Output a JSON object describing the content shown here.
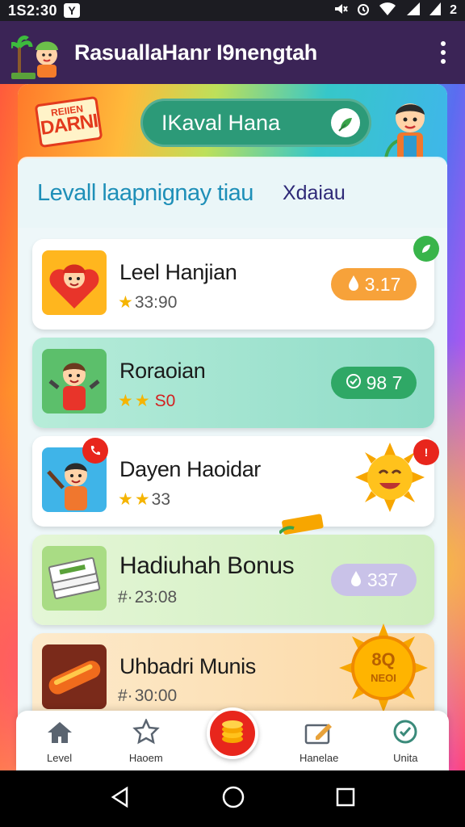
{
  "status_bar": {
    "time": "1S2:30",
    "notification": "Y",
    "battery": "2"
  },
  "app_bar": {
    "title": "RasuallaHanr I9nengtah",
    "logo_icon": "palm-tree-kid-icon",
    "menu_icon": "more-vert-icon"
  },
  "banner": {
    "badge_line1": "REIIEN",
    "badge_line2": "DARNI",
    "pill_text": "IKaval Hana"
  },
  "level_header": {
    "title": "Levall laapnignay tiau",
    "subtitle": "Xdaiau"
  },
  "items": [
    {
      "title": "Leel Hanjian",
      "meta": "33:90",
      "pill": "3.17",
      "stars": 1,
      "pill_color": "#f7a23a",
      "bg": "#ffffff"
    },
    {
      "title": "Roraoian",
      "meta": "S0",
      "pill": "98 7",
      "stars": 2,
      "pill_color": "#2fa866",
      "bg": "#8fdcc8"
    },
    {
      "title": "Dayen Haoidar",
      "meta": "33",
      "stars": 2,
      "bg": "#ffffff"
    },
    {
      "title": "Hadiuhah Bonus",
      "meta": "23:08",
      "pill": "337",
      "pill_color": "#c9c2e8",
      "bg": "#d9f1c9"
    },
    {
      "title": "Uhbadri Munis",
      "meta": "30:00",
      "bg": "#fde0b4",
      "sun_text_1": "8Q",
      "sun_text_2": "NEOI"
    }
  ],
  "bottom_nav": {
    "items": [
      {
        "label": "Level",
        "icon": "home-icon"
      },
      {
        "label": "Haoem",
        "icon": "puzzle-star-icon"
      },
      {
        "label": "",
        "icon": "coins-icon"
      },
      {
        "label": "Hanelae",
        "icon": "edit-card-icon"
      },
      {
        "label": "Unita",
        "icon": "compass-check-icon"
      }
    ]
  },
  "colors": {
    "app_bar": "#3b2456",
    "accent_blue": "#1e8fb8",
    "accent_red": "#e8261c"
  }
}
